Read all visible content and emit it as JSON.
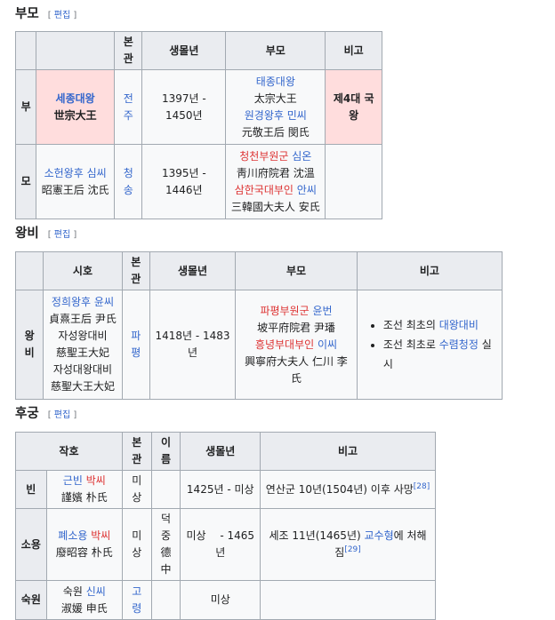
{
  "edit_label": "편집",
  "parents": {
    "heading": "부모",
    "headers": [
      "본관",
      "생몰년",
      "부모",
      "비고"
    ],
    "father": {
      "role": "부",
      "name_ko": "세종대왕",
      "name_hanja": "世宗大王",
      "clan": "전주",
      "years": "1397년 - 1450년",
      "parent1_ko": "태종대왕",
      "parent1_hanja": "太宗大王",
      "parent2_title": "원경왕후",
      "parent2_surname": "민씨",
      "parent2_hanja": "元敬王后 閔氏",
      "note": "제4대 국왕"
    },
    "mother": {
      "role": "모",
      "name_title": "소헌왕후",
      "name_surname": "심씨",
      "name_hanja": "昭憲王后 沈氏",
      "clan": "청송",
      "years": "1395년 - 1446년",
      "parent1_title": "청천부원군",
      "parent1_name": "심온",
      "parent1_hanja": "靑川府院君 沈溫",
      "parent2_title": "삼한국대부인",
      "parent2_name": "안씨",
      "parent2_hanja": "三韓國大夫人 安氏"
    }
  },
  "consort": {
    "heading": "왕비",
    "headers": [
      "시호",
      "본관",
      "생몰년",
      "부모",
      "비고"
    ],
    "row": {
      "role": "왕비",
      "title1_a": "정희왕후",
      "title1_b": "윤씨",
      "title1_hanja": "貞熹王后 尹氏",
      "title2": "자성왕대비",
      "title2_hanja": "慈聖王大妃",
      "title3": "자성대왕대비",
      "title3_hanja": "慈聖大王大妃",
      "clan": "파평",
      "years": "1418년 - 1483년",
      "parent1_title": "파평부원군",
      "parent1_name": "윤번",
      "parent1_hanja": "坡平府院君 尹璠",
      "parent2_title": "흥녕부대부인",
      "parent2_name": "이씨",
      "parent2_hanja": "興寧府大夫人 仁川 李氏",
      "note1_pre": "조선 최초의 ",
      "note1_link": "대왕대비",
      "note2_pre": "조선 최초로 ",
      "note2_link": "수렴청정",
      "note2_post": " 실시"
    }
  },
  "concubines": {
    "heading": "후궁",
    "headers": [
      "작호",
      "본관",
      "이름",
      "생몰년",
      "비고"
    ],
    "rows": [
      {
        "rank": "빈",
        "title_a": "근빈",
        "title_b": "박씨",
        "title_hanja": "謹嬪 朴氏",
        "clan": "미상",
        "name": "",
        "years": "1425년 - 미상",
        "note": "연산군 10년(1504년) 이후 사망",
        "ref": "[28]"
      },
      {
        "rank": "소용",
        "title_a": "폐소용",
        "title_b": "박씨",
        "title_hanja": "廢昭容 朴氏",
        "clan": "미상",
        "name": "덕중",
        "name_hanja": "德中",
        "years": "미상 　- 1465년",
        "note_pre": "세조 11년(1465년) ",
        "note_link": "교수형",
        "note_post": "에 처해짐",
        "ref": "[29]"
      },
      {
        "rank": "숙원",
        "title_a": "숙원",
        "title_b": "신씨",
        "title_hanja": "淑媛 申氏",
        "clan": "고령",
        "name": "",
        "years": "미상",
        "note": ""
      }
    ]
  }
}
